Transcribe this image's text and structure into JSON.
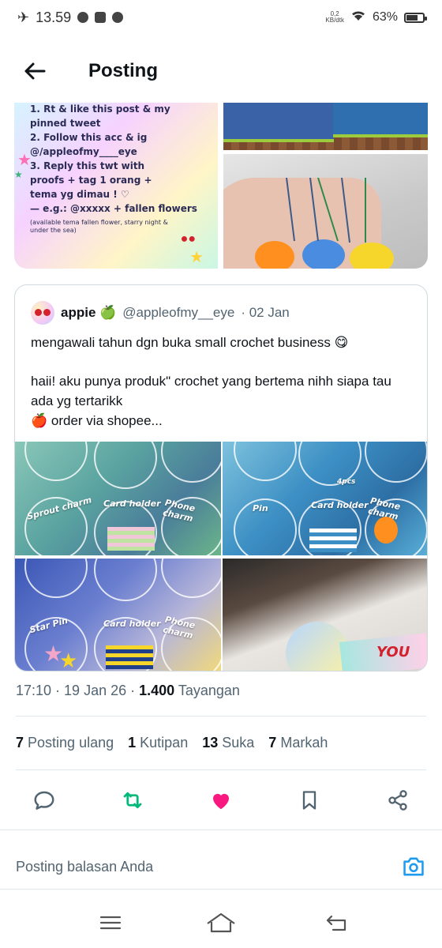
{
  "status_bar": {
    "time": "13.59",
    "net_speed_value": "0,2",
    "net_speed_unit": "KB/dtk",
    "battery": "63%"
  },
  "header": {
    "title": "Posting"
  },
  "rules_image": {
    "lines": "1. Rt & like this post & my\n    pinned tweet\n2. Follow this acc & ig\n    @/appleofmy____eye\n3. Reply this twt with\n    proofs + tag 1 orang +\n    tema yg dimau ! ♡\n— e.g.: @xxxxx + fallen flowers",
    "note": "(available tema fallen flower, starry night & under the sea)"
  },
  "quote": {
    "name": "appie 🍏",
    "handle": "@appleofmy__eye",
    "date": "· 02 Jan",
    "text1": "mengawali tahun dgn buka small crochet business 😋",
    "text2": "haii! aku punya produk\" crochet yang bertema nihh siapa tau ada yg tertarikk",
    "text3": "🍎 order via shopee...",
    "tiles": [
      {
        "labels": [
          "Sprout charm",
          "Card holder",
          "Phone charm"
        ]
      },
      {
        "labels": [
          "Pin",
          "Card holder",
          "Phone charm",
          "4pcs"
        ]
      },
      {
        "labels": [
          "Star Pin",
          "Card holder",
          "Phone charm"
        ]
      },
      {
        "labels": [
          "YOU"
        ]
      }
    ]
  },
  "meta": {
    "time_date": "17:10 · 19 Jan 26 · ",
    "views_count": "1.400",
    "views_label": "Tayangan"
  },
  "stats": [
    {
      "count": "7",
      "label": "Posting ulang"
    },
    {
      "count": "1",
      "label": "Kutipan"
    },
    {
      "count": "13",
      "label": "Suka"
    },
    {
      "count": "7",
      "label": "Markah"
    }
  ],
  "reply": {
    "placeholder": "Posting balasan Anda"
  },
  "colors": {
    "retweet_green": "#00ba7c",
    "like_pink": "#f91880",
    "accent_blue": "#1d9bf0",
    "text_dark": "#0f1419",
    "text_gray": "#536471"
  },
  "icons": {
    "back": "arrow-left-icon",
    "reply": "comment-icon",
    "retweet": "retweet-icon",
    "like": "heart-icon",
    "bookmark": "bookmark-icon",
    "share": "share-icon",
    "camera": "camera-icon"
  }
}
